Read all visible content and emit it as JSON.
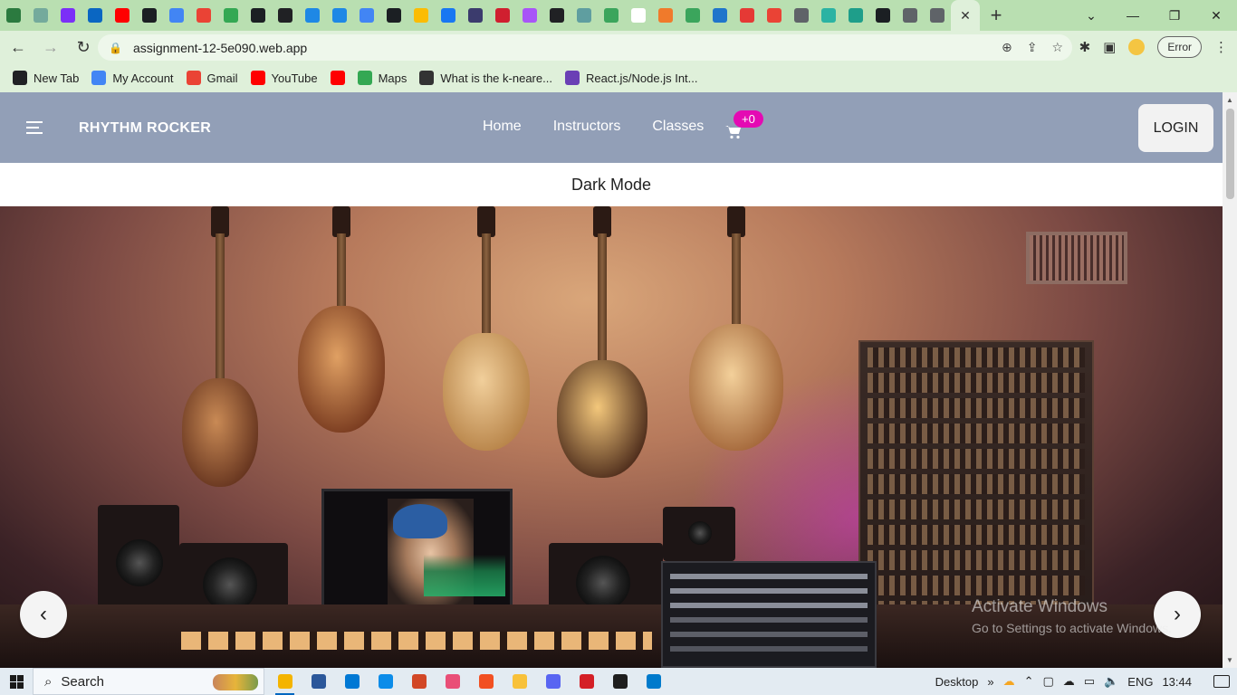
{
  "browser": {
    "tabs": [
      {
        "icon": "lines-icon",
        "color": "#2b7a3f"
      },
      {
        "icon": "openai-icon",
        "color": "#74aa9c"
      },
      {
        "icon": "p-icon",
        "color": "#7b2ff7"
      },
      {
        "icon": "linkedin-icon",
        "color": "#0a66c2"
      },
      {
        "icon": "youtube-icon",
        "color": "#ff0000"
      },
      {
        "icon": "github-icon",
        "color": "#1b1f23"
      },
      {
        "icon": "google-icon",
        "color": "#4285f4"
      },
      {
        "icon": "gmail-icon",
        "color": "#ea4335"
      },
      {
        "icon": "drive-icon",
        "color": "#34a853"
      },
      {
        "icon": "github-icon",
        "color": "#1b1f23"
      },
      {
        "icon": "globe-icon",
        "color": "#202124"
      },
      {
        "icon": "ibb-icon",
        "color": "#1e88e5"
      },
      {
        "icon": "ibb-icon",
        "color": "#1e88e5"
      },
      {
        "icon": "google-icon",
        "color": "#4285f4"
      },
      {
        "icon": "github-icon",
        "color": "#1b1f23"
      },
      {
        "icon": "drive-icon",
        "color": "#fbbc04"
      },
      {
        "icon": "facebook-icon",
        "color": "#1877f2"
      },
      {
        "icon": "app-icon",
        "color": "#3b3b6d"
      },
      {
        "icon": "n-icon",
        "color": "#d01f2f"
      },
      {
        "icon": "vite-icon",
        "color": "#a855f7"
      },
      {
        "icon": "globe-icon",
        "color": "#202124"
      },
      {
        "icon": "doc-icon",
        "color": "#5f9ea0"
      },
      {
        "icon": "c-icon",
        "color": "#3ba55c"
      },
      {
        "icon": "w-icon",
        "color": "#ffffff"
      },
      {
        "icon": "snowflake-icon",
        "color": "#f07a2b"
      },
      {
        "icon": "c-icon",
        "color": "#3ba55c"
      },
      {
        "icon": "is-icon",
        "color": "#1f75cb"
      },
      {
        "icon": "record-icon",
        "color": "#e53935"
      },
      {
        "icon": "gmail-icon",
        "color": "#ea4335"
      },
      {
        "icon": "chrome-icon",
        "color": "#5f6368"
      },
      {
        "icon": "sparkle-icon",
        "color": "#2bb3a3"
      },
      {
        "icon": "diamond-icon",
        "color": "#1e9e8a"
      },
      {
        "icon": "github-icon",
        "color": "#1b1f23"
      },
      {
        "icon": "chrome-icon",
        "color": "#5f6368"
      },
      {
        "icon": "chrome-icon",
        "color": "#5f6368"
      }
    ],
    "address": "assignment-12-5e090.web.app",
    "error_label": "Error",
    "bookmarks": [
      {
        "label": "New Tab",
        "icon": "globe-icon",
        "color": "#202124"
      },
      {
        "label": "My Account",
        "icon": "google-icon",
        "color": "#4285f4"
      },
      {
        "label": "Gmail",
        "icon": "gmail-icon",
        "color": "#ea4335"
      },
      {
        "label": "YouTube",
        "icon": "youtube-icon",
        "color": "#ff0000"
      },
      {
        "label": "",
        "icon": "youtube-icon",
        "color": "#ff0000"
      },
      {
        "label": "Maps",
        "icon": "maps-icon",
        "color": "#34a853"
      },
      {
        "label": "What is the k-neare...",
        "icon": "tree-icon",
        "color": "#333333"
      },
      {
        "label": "React.js/Node.js Int...",
        "icon": "grid-icon",
        "color": "#6a3fb5"
      }
    ]
  },
  "site": {
    "brand": "RHYTHM ROCKER",
    "nav": [
      {
        "label": "Home"
      },
      {
        "label": "Instructors"
      },
      {
        "label": "Classes"
      }
    ],
    "cart_badge": "+0",
    "login_label": "LOGIN",
    "dark_mode_label": "Dark Mode",
    "carousel": {
      "prev": "‹",
      "next": "›"
    },
    "watermark": {
      "line1": "Activate Windows",
      "line2": "Go to Settings to activate Windows."
    },
    "colors": {
      "navbar": "#929fb7",
      "badge": "#e40ab3"
    }
  },
  "taskbar": {
    "search_label": "Search",
    "apps": [
      {
        "icon": "chrome-icon",
        "color": "#f4b400",
        "active": true
      },
      {
        "icon": "word-icon",
        "color": "#2b579a"
      },
      {
        "icon": "mail-icon",
        "color": "#0078d4"
      },
      {
        "icon": "edge-icon",
        "color": "#0c8ce9"
      },
      {
        "icon": "wps-icon",
        "color": "#d24726"
      },
      {
        "icon": "paint-icon",
        "color": "#e94e77"
      },
      {
        "icon": "store-icon",
        "color": "#f25022"
      },
      {
        "icon": "folder-icon",
        "color": "#f8c13a"
      },
      {
        "icon": "discord-icon",
        "color": "#5865f2"
      },
      {
        "icon": "shield-icon",
        "color": "#d41f26"
      },
      {
        "icon": "terminal-icon",
        "color": "#1e1e1e"
      },
      {
        "icon": "vscode-icon",
        "color": "#007acc"
      }
    ],
    "desktop_label": "Desktop",
    "lang": "ENG",
    "time": "13:44"
  }
}
